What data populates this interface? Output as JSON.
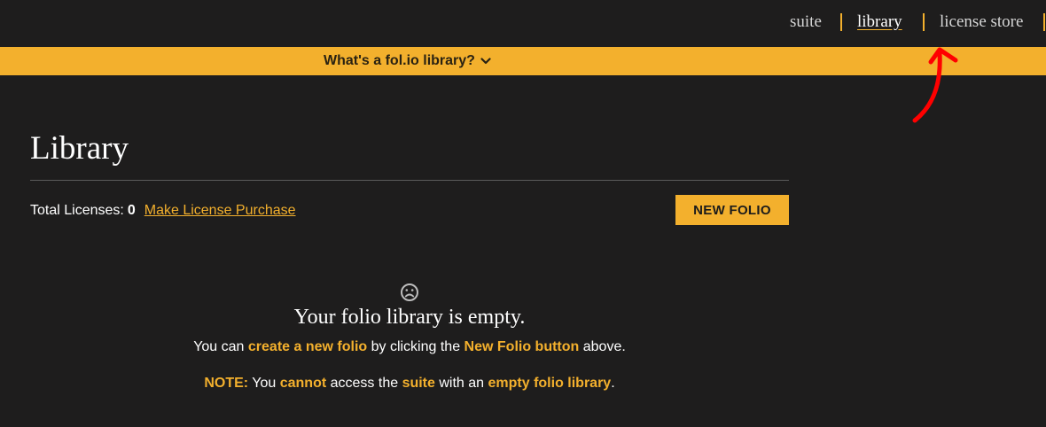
{
  "nav": {
    "items": [
      {
        "label": "suite"
      },
      {
        "label": "library"
      },
      {
        "label": "license store"
      }
    ]
  },
  "banner": {
    "label": "What's a fol.io library?",
    "icon": "chevron-down-icon"
  },
  "main": {
    "title": "Library",
    "licenses_label": "Total Licenses:",
    "licenses_count": "0",
    "purchase_link": "Make License Purchase",
    "new_folio_button": "NEW FOLIO"
  },
  "empty_state": {
    "icon": "sad-face-icon",
    "title": "Your folio library is empty.",
    "line1": {
      "part1": "You can ",
      "hl1": "create a new folio",
      "part2": " by clicking the ",
      "hl2": "New Folio button",
      "part3": " above."
    },
    "line2": {
      "hl0": "NOTE:",
      "part1": " You ",
      "hl1": "cannot",
      "part2": " access the ",
      "hl2": "suite",
      "part3": " with an ",
      "hl3": "empty folio library",
      "part4": "."
    }
  },
  "colors": {
    "background": "#1e1d1d",
    "accent": "#f3b02d",
    "annotation": "#ff0000"
  }
}
